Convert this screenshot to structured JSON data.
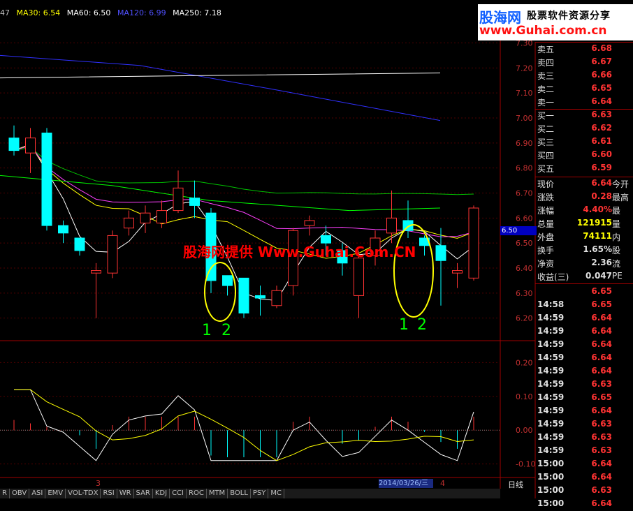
{
  "ma_bar": {
    "ma10": "47",
    "ma30": "MA30: 6.54",
    "ma60": "MA60: 6.50",
    "ma120": "MA120: 6.99",
    "ma250": "MA250: 7.18"
  },
  "logo": {
    "brand": "股海网",
    "slogan": "股票软件资源分享",
    "url": "www.Guhai.com.cn"
  },
  "watermark": "股海网提供 Www.Guhai.Com.CN",
  "annotations": [
    "1",
    "2",
    "1",
    "2"
  ],
  "price_axis": [
    "7.30",
    "7.20",
    "7.10",
    "7.00",
    "6.90",
    "6.80",
    "6.70",
    "6.60",
    "6.50",
    "6.40",
    "6.30",
    "6.20"
  ],
  "macd_axis": [
    "0.20",
    "0.10",
    "0.00",
    "-0.10"
  ],
  "current_price_marker": "6.50",
  "date_label": "2014/03/26/三",
  "bottom_marks": {
    "left": "3",
    "right": "4",
    "period": "日线"
  },
  "order_book": [
    {
      "label": "卖五",
      "value": "6.68"
    },
    {
      "label": "卖四",
      "value": "6.67"
    },
    {
      "label": "卖三",
      "value": "6.66"
    },
    {
      "label": "卖二",
      "value": "6.65"
    },
    {
      "label": "卖一",
      "value": "6.64"
    },
    {
      "label": "买一",
      "value": "6.63"
    },
    {
      "label": "买二",
      "value": "6.62"
    },
    {
      "label": "买三",
      "value": "6.61"
    },
    {
      "label": "买四",
      "value": "6.60"
    },
    {
      "label": "买五",
      "value": "6.59"
    }
  ],
  "stats": [
    {
      "label": "现价",
      "value": "6.64",
      "extra": "今开",
      "color": "#ff3333"
    },
    {
      "label": "涨跌",
      "value": "0.28",
      "extra": "最高",
      "color": "#ff3333"
    },
    {
      "label": "涨幅",
      "value": "4.40%",
      "extra": "最",
      "color": "#ff3333"
    },
    {
      "label": "总量",
      "value": "121915",
      "extra": "量",
      "color": "#ffff00"
    },
    {
      "label": "外盘",
      "value": "74111",
      "extra": "内",
      "color": "#ffff00"
    },
    {
      "label": "换手",
      "value": "1.65%",
      "extra": "股",
      "color": "#e0e0e0"
    },
    {
      "label": "净资",
      "value": "2.36",
      "extra": "流",
      "color": "#e0e0e0"
    },
    {
      "label": "收益(三)",
      "value": "0.047",
      "extra": "PE",
      "color": "#e0e0e0"
    }
  ],
  "ticks": [
    {
      "time": "",
      "price": "6.65"
    },
    {
      "time": "14:58",
      "price": "6.65"
    },
    {
      "time": "14:59",
      "price": "6.64"
    },
    {
      "time": "14:59",
      "price": "6.64"
    },
    {
      "time": "14:59",
      "price": "6.64"
    },
    {
      "time": "14:59",
      "price": "6.64"
    },
    {
      "time": "14:59",
      "price": "6.64"
    },
    {
      "time": "14:59",
      "price": "6.63"
    },
    {
      "time": "14:59",
      "price": "6.65"
    },
    {
      "time": "14:59",
      "price": "6.64"
    },
    {
      "time": "14:59",
      "price": "6.63"
    },
    {
      "time": "14:59",
      "price": "6.63"
    },
    {
      "time": "14:59",
      "price": "6.63"
    },
    {
      "time": "15:00",
      "price": "6.64"
    },
    {
      "time": "15:00",
      "price": "6.64"
    },
    {
      "time": "15:00",
      "price": "6.63"
    },
    {
      "time": "15:00",
      "price": "6.64"
    }
  ],
  "indicator_tabs": [
    "R",
    "OBV",
    "ASI",
    "EMV",
    "VOL-TDX",
    "RSI",
    "WR",
    "SAR",
    "KDJ",
    "CCI",
    "ROC",
    "MTM",
    "BOLL",
    "PSY",
    "MC"
  ],
  "colors": {
    "up": "#ff3333",
    "down": "#00ffff",
    "ma10": "#ffffff",
    "ma30": "#ffff00",
    "ma60": "#ff00ff",
    "ma120": "#00ff00",
    "ma250": "#0000ff"
  },
  "chart_data": {
    "type": "candlestick",
    "y_range": [
      6.16,
      7.36
    ],
    "candles": [
      {
        "o": 6.92,
        "c": 6.87,
        "h": 6.97,
        "l": 6.85
      },
      {
        "o": 6.86,
        "c": 6.92,
        "h": 6.96,
        "l": 6.78
      },
      {
        "o": 6.94,
        "c": 6.57,
        "h": 6.96,
        "l": 6.55
      },
      {
        "o": 6.57,
        "c": 6.54,
        "h": 6.59,
        "l": 6.5
      },
      {
        "o": 6.52,
        "c": 6.47,
        "h": 6.52,
        "l": 6.45
      },
      {
        "o": 6.38,
        "c": 6.39,
        "h": 6.42,
        "l": 6.2
      },
      {
        "o": 6.38,
        "c": 6.53,
        "h": 6.55,
        "l": 6.36
      },
      {
        "o": 6.56,
        "c": 6.6,
        "h": 6.63,
        "l": 6.53
      },
      {
        "o": 6.58,
        "c": 6.62,
        "h": 6.65,
        "l": 6.54
      },
      {
        "o": 6.58,
        "c": 6.63,
        "h": 6.67,
        "l": 6.56
      },
      {
        "o": 6.63,
        "c": 6.72,
        "h": 6.79,
        "l": 6.62
      },
      {
        "o": 6.68,
        "c": 6.65,
        "h": 6.75,
        "l": 6.6
      },
      {
        "o": 6.62,
        "c": 6.35,
        "h": 6.64,
        "l": 6.3
      },
      {
        "o": 6.37,
        "c": 6.33,
        "h": 6.37,
        "l": 6.29
      },
      {
        "o": 6.36,
        "c": 6.22,
        "h": 6.36,
        "l": 6.2
      },
      {
        "o": 6.29,
        "c": 6.28,
        "h": 6.33,
        "l": 6.21
      },
      {
        "o": 6.25,
        "c": 6.31,
        "h": 6.33,
        "l": 6.24
      },
      {
        "o": 6.33,
        "c": 6.55,
        "h": 6.56,
        "l": 6.29
      },
      {
        "o": 6.57,
        "c": 6.59,
        "h": 6.61,
        "l": 6.53
      },
      {
        "o": 6.53,
        "c": 6.5,
        "h": 6.57,
        "l": 6.45
      },
      {
        "o": 6.47,
        "c": 6.42,
        "h": 6.5,
        "l": 6.37
      },
      {
        "o": 6.29,
        "c": 6.44,
        "h": 6.47,
        "l": 6.2
      },
      {
        "o": 6.45,
        "c": 6.52,
        "h": 6.55,
        "l": 6.41
      },
      {
        "o": 6.54,
        "c": 6.6,
        "h": 6.71,
        "l": 6.5
      },
      {
        "o": 6.59,
        "c": 6.55,
        "h": 6.67,
        "l": 6.52
      },
      {
        "o": 6.52,
        "c": 6.49,
        "h": 6.53,
        "l": 6.45
      },
      {
        "o": 6.49,
        "c": 6.43,
        "h": 6.56,
        "l": 6.25
      },
      {
        "o": 6.38,
        "c": 6.39,
        "h": 6.42,
        "l": 6.32
      },
      {
        "o": 6.36,
        "c": 6.64,
        "h": 6.65,
        "l": 6.35
      }
    ],
    "macd_y_range": [
      -0.14,
      0.24
    ]
  }
}
